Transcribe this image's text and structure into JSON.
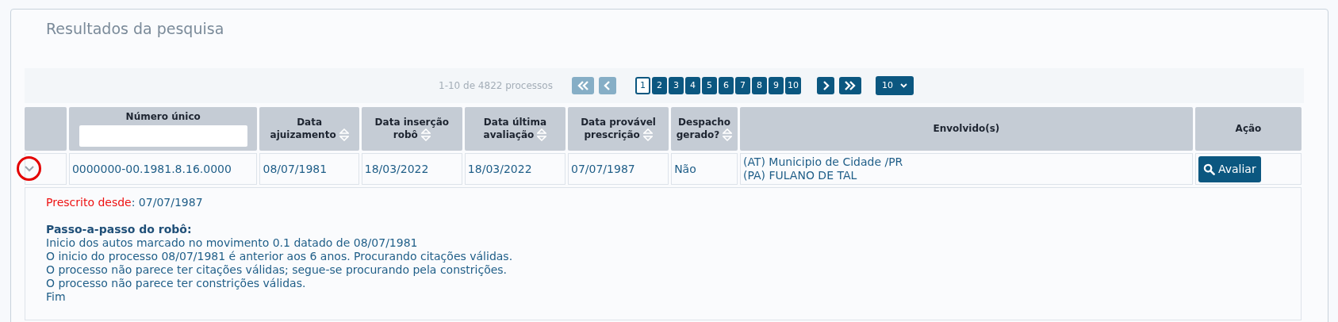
{
  "panel": {
    "title": "Resultados da pesquisa"
  },
  "pagination": {
    "summary": "1-10 de 4822 processos",
    "first_disabled": true,
    "prev_disabled": true,
    "next_disabled": false,
    "last_disabled": false,
    "pages": [
      {
        "label": "1",
        "selected": true
      },
      {
        "label": "2",
        "selected": false
      },
      {
        "label": "3",
        "selected": false
      },
      {
        "label": "4",
        "selected": false
      },
      {
        "label": "5",
        "selected": false
      },
      {
        "label": "6",
        "selected": false
      },
      {
        "label": "7",
        "selected": false
      },
      {
        "label": "8",
        "selected": false
      },
      {
        "label": "9",
        "selected": false
      },
      {
        "label": "10",
        "selected": false
      }
    ],
    "page_size": "10"
  },
  "table": {
    "columns": [
      {
        "label": "Número único",
        "kind": "filter"
      },
      {
        "label": "Data ajuizamento",
        "kind": "sort"
      },
      {
        "label": "Data inserção robô",
        "kind": "sort"
      },
      {
        "label": "Data última avaliação",
        "kind": "sort"
      },
      {
        "label": "Data provável prescrição",
        "kind": "sort"
      },
      {
        "label": "Despacho gerado?",
        "kind": "sort"
      },
      {
        "label": "Envolvido(s)",
        "kind": "plain"
      },
      {
        "label": "Ação",
        "kind": "plain"
      }
    ],
    "rows": [
      {
        "expanded": true,
        "numero": "0000000-00.1981.8.16.0000",
        "ajuizamento": "08/07/1981",
        "insercao": "18/03/2022",
        "ultima": "18/03/2022",
        "provavel": "07/07/1987",
        "despacho": "Não",
        "envolvidos": [
          "(AT) Municipio de Cidade /PR",
          "(PA) FULANO DE TAL"
        ],
        "action": "Avaliar",
        "detail": {
          "prescrito_label": "Prescrito desde",
          "prescrito_value": ": 07/07/1987",
          "steps_title": "Passo-a-passo do robô:",
          "steps": [
            "Inicio dos autos marcado no movimento 0.1 datado de 08/07/1981",
            "O inicio do processo 08/07/1981 é anterior aos 6 anos. Procurando citações válidas.",
            "O processo não parece ter citações válidas; segue-se procurando pela constrições.",
            "O processo não parece ter constrições válidas.",
            "Fim"
          ]
        }
      }
    ]
  }
}
